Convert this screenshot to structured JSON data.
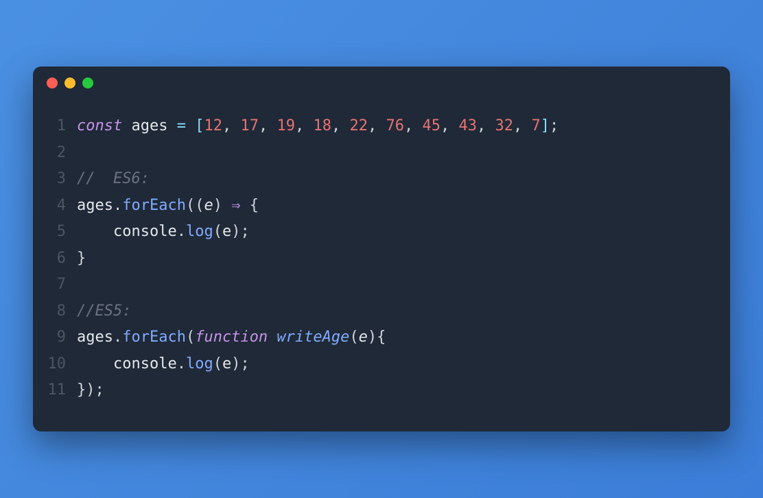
{
  "window": {
    "traffic_lights": [
      "close",
      "minimize",
      "zoom"
    ]
  },
  "code": {
    "lines": [
      {
        "n": "1",
        "tokens": [
          {
            "cls": "tok-keyword",
            "t": "const"
          },
          {
            "cls": "tok-ident",
            "t": " ages "
          },
          {
            "cls": "tok-op",
            "t": "="
          },
          {
            "cls": "tok-ident",
            "t": " "
          },
          {
            "cls": "tok-bracket",
            "t": "["
          },
          {
            "cls": "tok-number",
            "t": "12"
          },
          {
            "cls": "tok-punct",
            "t": ", "
          },
          {
            "cls": "tok-number",
            "t": "17"
          },
          {
            "cls": "tok-punct",
            "t": ", "
          },
          {
            "cls": "tok-number",
            "t": "19"
          },
          {
            "cls": "tok-punct",
            "t": ", "
          },
          {
            "cls": "tok-number",
            "t": "18"
          },
          {
            "cls": "tok-punct",
            "t": ", "
          },
          {
            "cls": "tok-number",
            "t": "22"
          },
          {
            "cls": "tok-punct",
            "t": ", "
          },
          {
            "cls": "tok-number",
            "t": "76"
          },
          {
            "cls": "tok-punct",
            "t": ", "
          },
          {
            "cls": "tok-number",
            "t": "45"
          },
          {
            "cls": "tok-punct",
            "t": ", "
          },
          {
            "cls": "tok-number",
            "t": "43"
          },
          {
            "cls": "tok-punct",
            "t": ", "
          },
          {
            "cls": "tok-number",
            "t": "32"
          },
          {
            "cls": "tok-punct",
            "t": ", "
          },
          {
            "cls": "tok-number",
            "t": "7"
          },
          {
            "cls": "tok-bracket",
            "t": "]"
          },
          {
            "cls": "tok-punct",
            "t": ";"
          }
        ]
      },
      {
        "n": "2",
        "tokens": []
      },
      {
        "n": "3",
        "tokens": [
          {
            "cls": "tok-comment",
            "t": "//  ES6:"
          }
        ]
      },
      {
        "n": "4",
        "tokens": [
          {
            "cls": "tok-ident",
            "t": "ages"
          },
          {
            "cls": "tok-punct",
            "t": "."
          },
          {
            "cls": "tok-method",
            "t": "forEach"
          },
          {
            "cls": "tok-punct",
            "t": "(("
          },
          {
            "cls": "tok-param",
            "t": "e"
          },
          {
            "cls": "tok-punct",
            "t": ") "
          },
          {
            "cls": "tok-arrow",
            "t": "⇒"
          },
          {
            "cls": "tok-punct",
            "t": " {"
          }
        ]
      },
      {
        "n": "5",
        "tokens": [
          {
            "cls": "tok-ident",
            "t": "    console"
          },
          {
            "cls": "tok-punct",
            "t": "."
          },
          {
            "cls": "tok-method",
            "t": "log"
          },
          {
            "cls": "tok-punct",
            "t": "("
          },
          {
            "cls": "tok-ident",
            "t": "e"
          },
          {
            "cls": "tok-punct",
            "t": ");"
          }
        ]
      },
      {
        "n": "6",
        "tokens": [
          {
            "cls": "tok-punct",
            "t": "}"
          }
        ]
      },
      {
        "n": "7",
        "tokens": []
      },
      {
        "n": "8",
        "tokens": [
          {
            "cls": "tok-comment",
            "t": "//ES5:"
          }
        ]
      },
      {
        "n": "9",
        "tokens": [
          {
            "cls": "tok-ident",
            "t": "ages"
          },
          {
            "cls": "tok-punct",
            "t": "."
          },
          {
            "cls": "tok-method",
            "t": "forEach"
          },
          {
            "cls": "tok-punct",
            "t": "("
          },
          {
            "cls": "tok-keyword",
            "t": "function"
          },
          {
            "cls": "tok-ident",
            "t": " "
          },
          {
            "cls": "tok-fname",
            "t": "writeAge"
          },
          {
            "cls": "tok-punct",
            "t": "("
          },
          {
            "cls": "tok-param",
            "t": "e"
          },
          {
            "cls": "tok-punct",
            "t": "){"
          }
        ]
      },
      {
        "n": "10",
        "tokens": [
          {
            "cls": "tok-ident",
            "t": "    console"
          },
          {
            "cls": "tok-punct",
            "t": "."
          },
          {
            "cls": "tok-method",
            "t": "log"
          },
          {
            "cls": "tok-punct",
            "t": "("
          },
          {
            "cls": "tok-ident",
            "t": "e"
          },
          {
            "cls": "tok-punct",
            "t": ");"
          }
        ]
      },
      {
        "n": "11",
        "tokens": [
          {
            "cls": "tok-punct",
            "t": "});"
          }
        ]
      }
    ]
  }
}
